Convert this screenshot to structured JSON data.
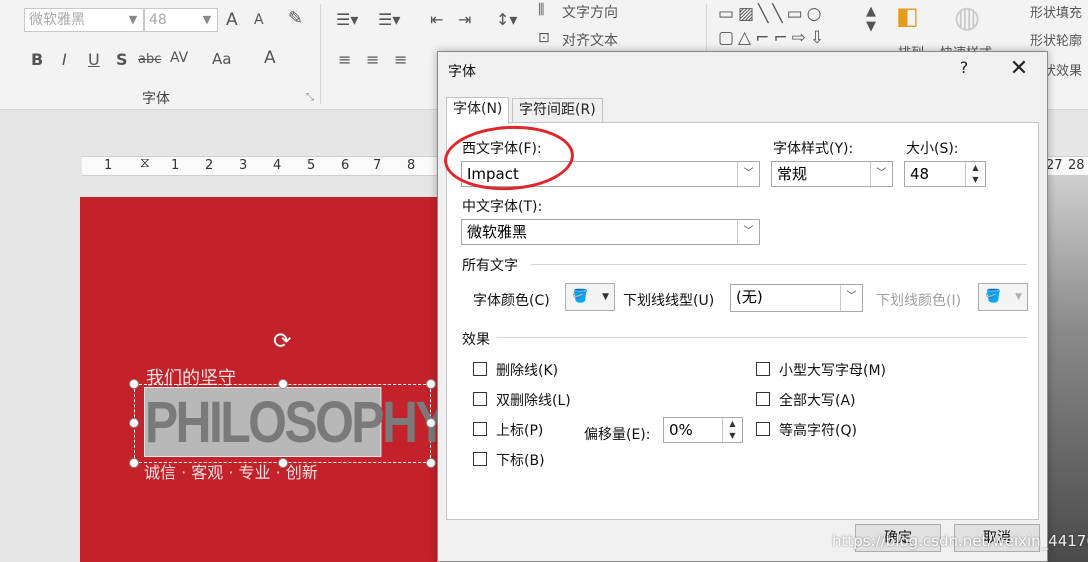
{
  "ribbon": {
    "font_name": "微软雅黑",
    "font_size": "48",
    "grow_font": "A",
    "shrink_font": "A",
    "bold": "B",
    "italic": "I",
    "underline": "U",
    "shadow": "S",
    "strikethrough": "abc",
    "spacing": "AV",
    "case": "Aa",
    "font_color": "A",
    "font_group_label": "字体",
    "text_direction": "文字方向",
    "align_text": "对齐文本",
    "arrange": "排列",
    "quick_styles": "快速样式",
    "shape_fill": "形状填充",
    "shape_outline": "形状轮廓",
    "shape_effects": "形状效果"
  },
  "ruler": {
    "ticks": [
      "1",
      "1",
      "2",
      "3",
      "4",
      "5",
      "6",
      "7",
      "8"
    ],
    "right_ticks": [
      "27",
      "28"
    ]
  },
  "slide": {
    "subtitle": "我们的坚守",
    "title": "PHILOSOPHY",
    "tagline": "诚信 · 客观 · 专业 · 创新"
  },
  "dialog": {
    "title": "字体",
    "help": "?",
    "tabs": [
      {
        "label": "字体(N)",
        "active": true
      },
      {
        "label": "字符间距(R)",
        "active": false
      }
    ],
    "latin_font_label": "西文字体(F):",
    "latin_font_value": "Impact",
    "style_label": "字体样式(Y):",
    "style_value": "常规",
    "size_label": "大小(S):",
    "size_value": "48",
    "cjk_font_label": "中文字体(T):",
    "cjk_font_value": "微软雅黑",
    "all_text_label": "所有文字",
    "font_color_label": "字体颜色(C)",
    "underline_style_label": "下划线线型(U)",
    "underline_style_value": "(无)",
    "underline_color_label": "下划线颜色(I)",
    "effects_label": "效果",
    "effects": {
      "strikethrough": "删除线(K)",
      "double_strikethrough": "双删除线(L)",
      "superscript": "上标(P)",
      "subscript": "下标(B)",
      "small_caps": "小型大写字母(M)",
      "all_caps": "全部大写(A)",
      "equalize_height": "等高字符(Q)"
    },
    "offset_label": "偏移量(E):",
    "offset_value": "0%",
    "ok": "确定",
    "cancel": "取消"
  },
  "watermark": "https://blog.csdn.net/weixin_44176423",
  "colors": {
    "slide_bg": "#c3222b",
    "annotation": "#e0262b"
  }
}
